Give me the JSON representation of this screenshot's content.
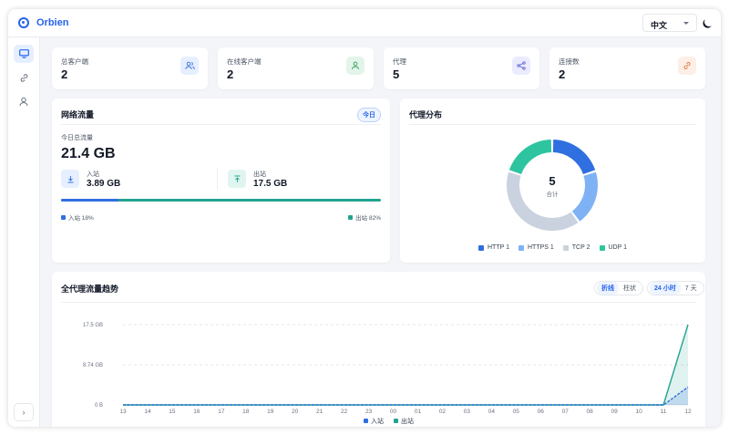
{
  "app": {
    "brand": "Orbien",
    "language": "中文",
    "sidebar_expand": "›"
  },
  "colors": {
    "accent": "#2563eb",
    "inbound": "#2f6fe0",
    "outbound": "#22a390",
    "http": "#2f6fe0",
    "https": "#7fb2f5",
    "tcp": "#c9d2de",
    "udp": "#2ec4a0"
  },
  "stats": [
    {
      "label": "总客户端",
      "value": "2",
      "icon": "users-icon",
      "bg": "#e6efff",
      "fg": "#3b6fd8"
    },
    {
      "label": "在线客户端",
      "value": "2",
      "icon": "user-check-icon",
      "bg": "#e3f5ea",
      "fg": "#2f9e5b"
    },
    {
      "label": "代理",
      "value": "5",
      "icon": "share-icon",
      "bg": "#ebebff",
      "fg": "#5b5fd6"
    },
    {
      "label": "连接数",
      "value": "2",
      "icon": "link-icon",
      "bg": "#fdeee6",
      "fg": "#e0773f"
    }
  ],
  "traffic": {
    "title": "网络流量",
    "badge": "今日",
    "total_label": "今日总流量",
    "total_value": "21.4 GB",
    "in_label": "入站",
    "in_value": "3.89 GB",
    "out_label": "出站",
    "out_value": "17.5 GB",
    "in_share": 0.18,
    "in_legend": "入站 18%",
    "out_legend": "出站 82%"
  },
  "proxy_dist": {
    "title": "代理分布",
    "total": "5",
    "total_label": "合计",
    "items": [
      {
        "name": "HTTP",
        "count": 1,
        "color": "#2f6fe0"
      },
      {
        "name": "HTTPS",
        "count": 1,
        "color": "#7fb2f5"
      },
      {
        "name": "TCP",
        "count": 2,
        "color": "#c9d2de"
      },
      {
        "name": "UDP",
        "count": 1,
        "color": "#2ec4a0"
      }
    ]
  },
  "trend": {
    "title": "全代理流量趋势",
    "chart_types": [
      "折线",
      "柱状"
    ],
    "ranges": [
      "24 小时",
      "7 天"
    ],
    "legend": [
      "入站",
      "出站"
    ]
  },
  "chart_data": {
    "type": "area",
    "x": [
      "13",
      "14",
      "15",
      "16",
      "17",
      "18",
      "19",
      "20",
      "21",
      "22",
      "23",
      "00",
      "01",
      "02",
      "03",
      "04",
      "05",
      "06",
      "07",
      "08",
      "09",
      "10",
      "11",
      "12"
    ],
    "y_ticks": [
      "17.5 GB",
      "8.74 GB",
      "0 B"
    ],
    "ylim_gb": [
      0,
      17.5
    ],
    "series": [
      {
        "name": "入站",
        "values_gb": [
          0,
          0,
          0,
          0,
          0,
          0,
          0,
          0,
          0,
          0,
          0,
          0,
          0,
          0,
          0,
          0,
          0,
          0,
          0,
          0,
          0,
          0,
          0,
          3.89
        ],
        "color": "#2f6fe0"
      },
      {
        "name": "出站",
        "values_gb": [
          0,
          0,
          0,
          0,
          0,
          0,
          0,
          0,
          0,
          0,
          0,
          0,
          0,
          0,
          0,
          0,
          0,
          0,
          0,
          0,
          0,
          0,
          0,
          17.5
        ],
        "color": "#22a390"
      }
    ],
    "grid": true,
    "legend_position": "bottom"
  }
}
